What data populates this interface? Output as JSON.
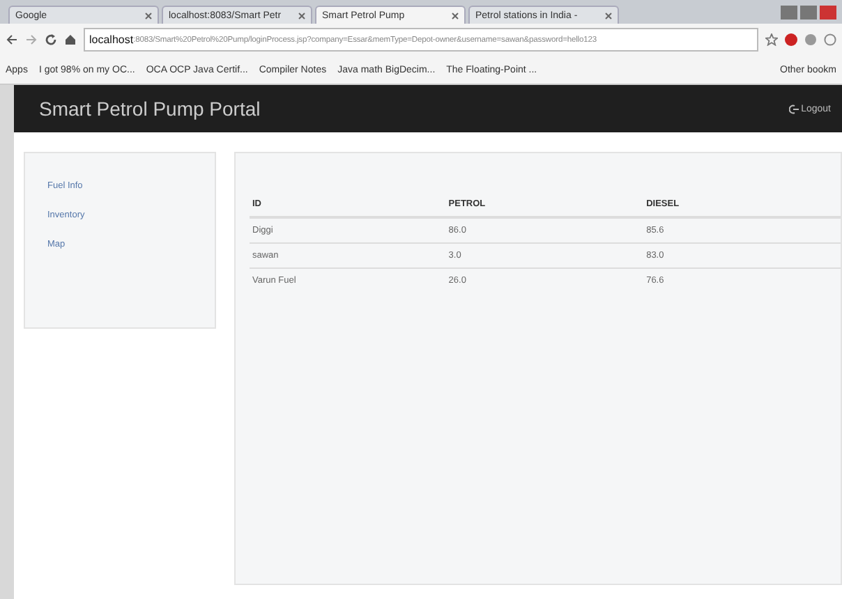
{
  "browser": {
    "tabs": [
      {
        "label": "Google",
        "selected": false
      },
      {
        "label": "localhost:8083/Smart Petr",
        "selected": false
      },
      {
        "label": "Smart Petrol Pump",
        "selected": true
      },
      {
        "label": "Petrol stations in India -",
        "selected": false
      }
    ],
    "url_host": "localhost",
    "url_rest": ":8083/Smart%20Petrol%20Pump/loginProcess.jsp?company=Essar&memType=Depot-owner&username=sawan&password=hello123",
    "bookmarks": [
      "Apps",
      "I got 98% on my OC...",
      "OCA OCP Java Certif...",
      "Compiler Notes",
      "Java math BigDecim...",
      "The Floating-Point ..."
    ],
    "other_bookmarks": "Other bookm"
  },
  "header": {
    "title": "Smart Petrol Pump Portal",
    "logout": "Logout"
  },
  "sidebar": {
    "items": [
      "Fuel Info",
      "Inventory",
      "Map"
    ]
  },
  "table": {
    "columns": [
      "ID",
      "PETROL",
      "DIESEL"
    ],
    "rows": [
      [
        "Diggi",
        "86.0",
        "85.6"
      ],
      [
        "sawan",
        "3.0",
        "83.0"
      ],
      [
        "Varun Fuel",
        "26.0",
        "76.6"
      ]
    ]
  }
}
